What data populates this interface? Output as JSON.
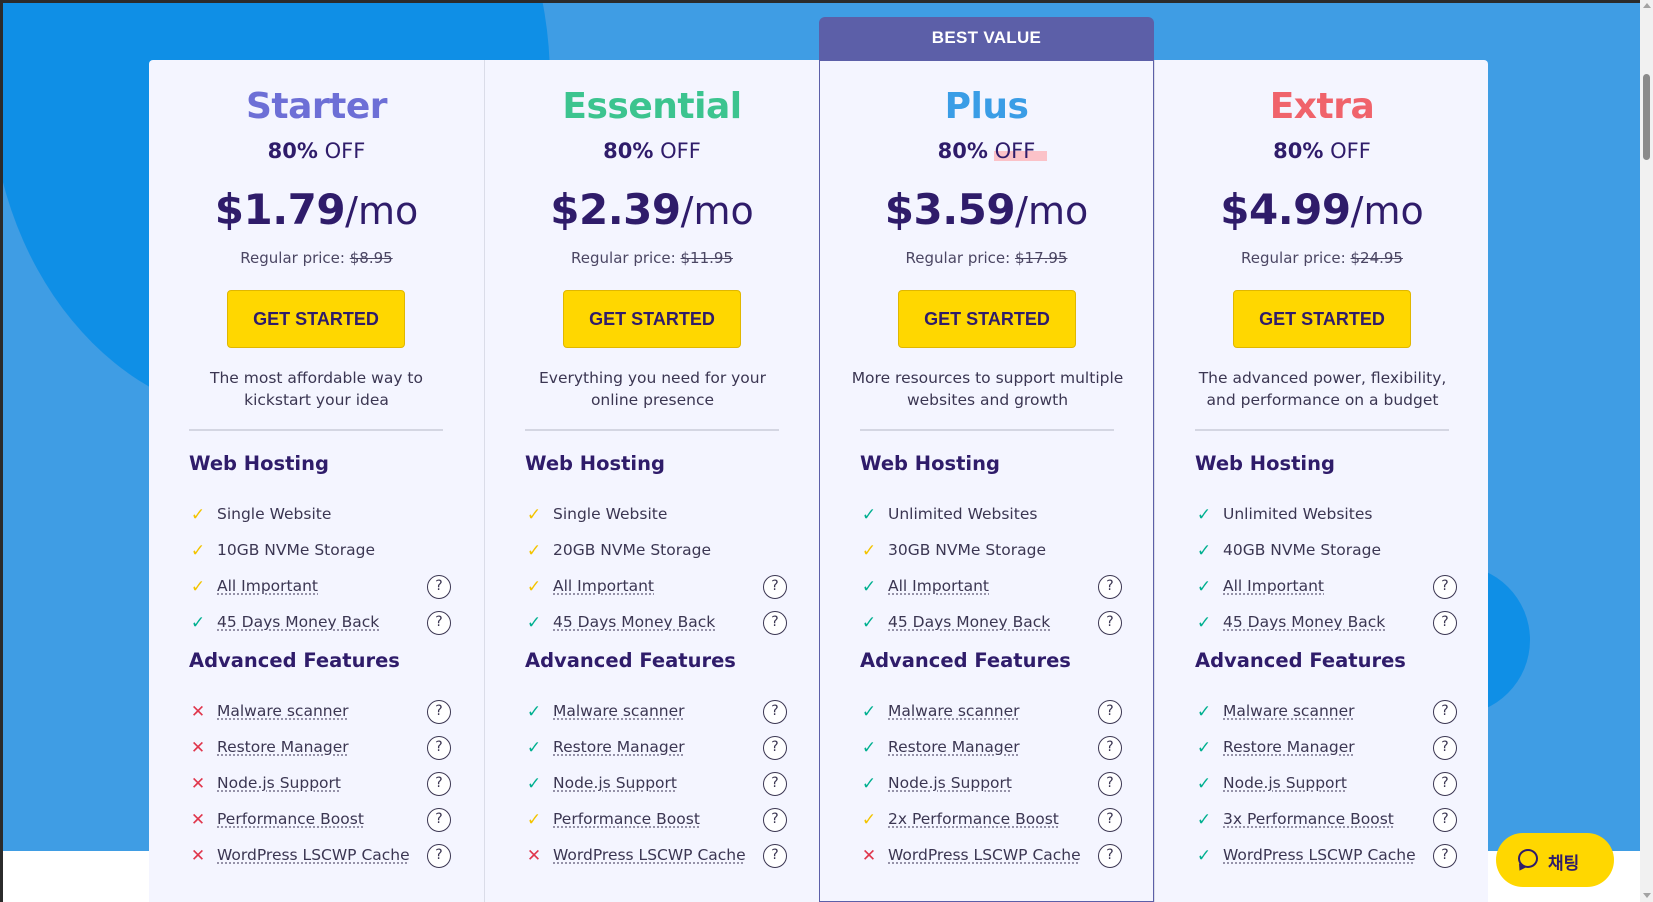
{
  "banner": {
    "label": "BEST VALUE"
  },
  "plans": [
    {
      "name": "Starter",
      "color": "#6d6fd6",
      "discount_pct": "80%",
      "discount_off": "OFF",
      "price": "$1.79",
      "per": "/mo",
      "regular_label": "Regular price:",
      "regular_price": "$8.95",
      "cta": "GET STARTED",
      "description": "The most affordable way to kickstart your idea",
      "hosting_title": "Web Hosting",
      "hosting": [
        {
          "label": "Single Website",
          "mark": "check-yellow",
          "help": false
        },
        {
          "label": "10GB NVMe Storage",
          "mark": "check-yellow",
          "help": false
        },
        {
          "label": "All Important",
          "mark": "check-yellow",
          "help": true
        },
        {
          "label": "45 Days Money Back",
          "mark": "check-green",
          "help": true
        }
      ],
      "advanced_title": "Advanced Features",
      "advanced": [
        {
          "label": "Malware scanner",
          "mark": "cross"
        },
        {
          "label": "Restore Manager",
          "mark": "cross"
        },
        {
          "label": "Node.js Support",
          "mark": "cross"
        },
        {
          "label": "Performance Boost",
          "mark": "cross"
        },
        {
          "label": "WordPress LSCWP Cache",
          "mark": "cross"
        }
      ]
    },
    {
      "name": "Essential",
      "color": "#3cc48f",
      "discount_pct": "80%",
      "discount_off": "OFF",
      "price": "$2.39",
      "per": "/mo",
      "regular_label": "Regular price:",
      "regular_price": "$11.95",
      "cta": "GET STARTED",
      "description": "Everything you need for your online presence",
      "hosting_title": "Web Hosting",
      "hosting": [
        {
          "label": "Single Website",
          "mark": "check-yellow",
          "help": false
        },
        {
          "label": "20GB NVMe Storage",
          "mark": "check-yellow",
          "help": false
        },
        {
          "label": "All Important",
          "mark": "check-yellow",
          "help": true
        },
        {
          "label": "45 Days Money Back",
          "mark": "check-green",
          "help": true
        }
      ],
      "advanced_title": "Advanced Features",
      "advanced": [
        {
          "label": "Malware scanner",
          "mark": "check-green"
        },
        {
          "label": "Restore Manager",
          "mark": "check-green"
        },
        {
          "label": "Node.js Support",
          "mark": "check-green"
        },
        {
          "label": "Performance Boost",
          "mark": "check-yellow"
        },
        {
          "label": "WordPress LSCWP Cache",
          "mark": "cross"
        }
      ]
    },
    {
      "name": "Plus",
      "color": "#3a9de6",
      "discount_pct": "80%",
      "discount_off": "OFF",
      "price": "$3.59",
      "per": "/mo",
      "regular_label": "Regular price:",
      "regular_price": "$17.95",
      "cta": "GET STARTED",
      "description": "More resources to support multiple websites and growth",
      "hosting_title": "Web Hosting",
      "hosting": [
        {
          "label": "Unlimited Websites",
          "mark": "check-green",
          "help": false
        },
        {
          "label": "30GB NVMe Storage",
          "mark": "check-yellow",
          "help": false
        },
        {
          "label": "All Important",
          "mark": "check-green",
          "help": true
        },
        {
          "label": "45 Days Money Back",
          "mark": "check-green",
          "help": true
        }
      ],
      "advanced_title": "Advanced Features",
      "advanced": [
        {
          "label": "Malware scanner",
          "mark": "check-green"
        },
        {
          "label": "Restore Manager",
          "mark": "check-green"
        },
        {
          "label": "Node.js Support",
          "mark": "check-green"
        },
        {
          "label": "2x Performance Boost",
          "mark": "check-yellow"
        },
        {
          "label": "WordPress LSCWP Cache",
          "mark": "cross"
        }
      ]
    },
    {
      "name": "Extra",
      "color": "#f0636b",
      "discount_pct": "80%",
      "discount_off": "OFF",
      "price": "$4.99",
      "per": "/mo",
      "regular_label": "Regular price:",
      "regular_price": "$24.95",
      "cta": "GET STARTED",
      "description": "The advanced power, flexibility, and performance on a budget",
      "hosting_title": "Web Hosting",
      "hosting": [
        {
          "label": "Unlimited Websites",
          "mark": "check-green",
          "help": false
        },
        {
          "label": "40GB NVMe Storage",
          "mark": "check-green",
          "help": false
        },
        {
          "label": "All Important",
          "mark": "check-green",
          "help": true
        },
        {
          "label": "45 Days Money Back",
          "mark": "check-green",
          "help": true
        }
      ],
      "advanced_title": "Advanced Features",
      "advanced": [
        {
          "label": "Malware scanner",
          "mark": "check-green"
        },
        {
          "label": "Restore Manager",
          "mark": "check-green"
        },
        {
          "label": "Node.js Support",
          "mark": "check-green"
        },
        {
          "label": "3x Performance Boost",
          "mark": "check-green"
        },
        {
          "label": "WordPress LSCWP Cache",
          "mark": "check-green"
        }
      ]
    }
  ],
  "chat": {
    "label": "채팅",
    "icon": "chat-bubble-icon"
  },
  "icons": {
    "check": "check-icon",
    "cross": "cross-icon",
    "help": "help-icon"
  },
  "help_glyph": "?"
}
